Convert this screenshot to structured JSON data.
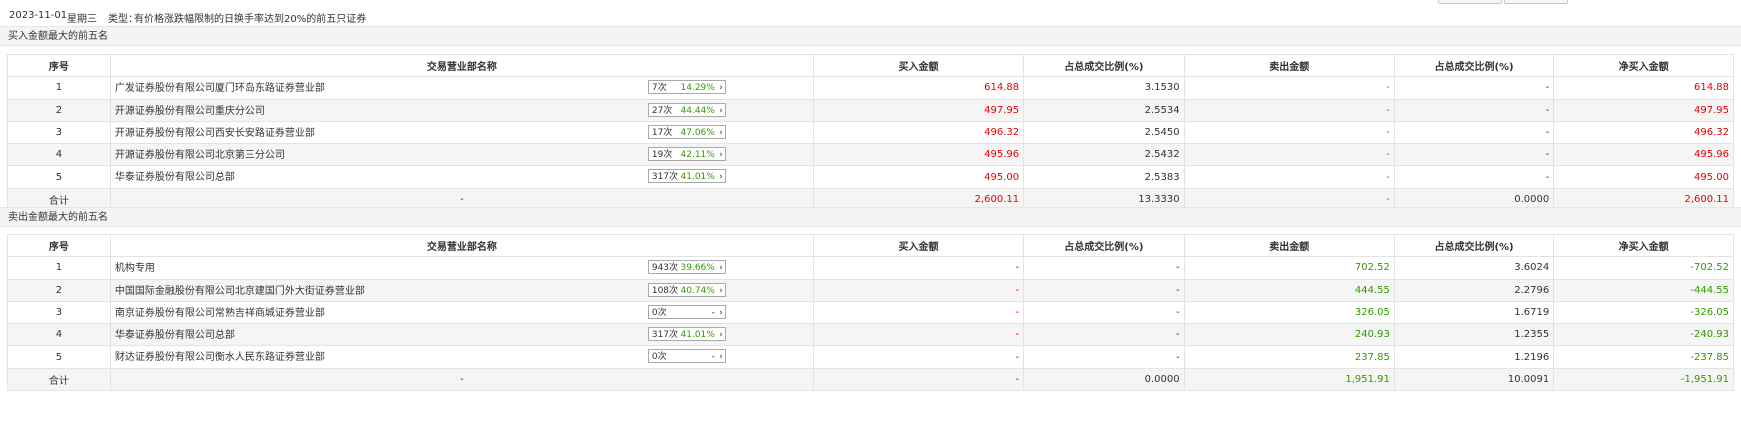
{
  "header": {
    "date": "2023-11-01",
    "weekday": "星期三",
    "type_label": "类型：",
    "type_value": "有价格涨跌幅限制的日换手率达到20%的前五只证券"
  },
  "columns": [
    "序号",
    "交易营业部名称",
    "买入金额",
    "占总成交比例(%)",
    "卖出金额",
    "占总成交比例(%)",
    "净买入金额"
  ],
  "buy_section": {
    "title": "买入金额最大的前五名",
    "rows": [
      {
        "no": "1",
        "name": "广发证券股份有限公司厦门环岛东路证券营业部",
        "count": "7次",
        "rate": "14.29%",
        "arrow": "›",
        "buy": "614.88",
        "buy_pct": "3.1530",
        "sell": "-",
        "sell_pct": "-",
        "net": "614.88"
      },
      {
        "no": "2",
        "name": "开源证券股份有限公司重庆分公司",
        "count": "27次",
        "rate": "44.44%",
        "arrow": "›",
        "buy": "497.95",
        "buy_pct": "2.5534",
        "sell": "-",
        "sell_pct": "-",
        "net": "497.95"
      },
      {
        "no": "3",
        "name": "开源证券股份有限公司西安长安路证券营业部",
        "count": "17次",
        "rate": "47.06%",
        "arrow": "›",
        "buy": "496.32",
        "buy_pct": "2.5450",
        "sell": "-",
        "sell_pct": "-",
        "net": "496.32"
      },
      {
        "no": "4",
        "name": "开源证券股份有限公司北京第三分公司",
        "count": "19次",
        "rate": "42.11%",
        "arrow": "›",
        "buy": "495.96",
        "buy_pct": "2.5432",
        "sell": "-",
        "sell_pct": "-",
        "net": "495.96"
      },
      {
        "no": "5",
        "name": "华泰证券股份有限公司总部",
        "count": "317次",
        "rate": "41.01%",
        "arrow": "›",
        "buy": "495.00",
        "buy_pct": "2.5383",
        "sell": "-",
        "sell_pct": "-",
        "net": "495.00"
      }
    ],
    "total": {
      "label": "合计",
      "name": "-",
      "buy": "2,600.11",
      "buy_pct": "13.3330",
      "sell": "-",
      "sell_pct": "0.0000",
      "net": "2,600.11"
    }
  },
  "sell_section": {
    "title": "卖出金额最大的前五名",
    "rows": [
      {
        "no": "1",
        "name": "机构专用",
        "count": "943次",
        "rate": "39.66%",
        "arrow": "›",
        "buy": "-",
        "buy_pct": "-",
        "sell": "702.52",
        "sell_pct": "3.6024",
        "net": "-702.52"
      },
      {
        "no": "2",
        "name": "中国国际金融股份有限公司北京建国门外大街证券营业部",
        "count": "108次",
        "rate": "40.74%",
        "arrow": "›",
        "buy": "-",
        "buy_pct": "-",
        "sell": "444.55",
        "sell_pct": "2.2796",
        "net": "-444.55"
      },
      {
        "no": "3",
        "name": "南京证券股份有限公司常熟吉祥商城证券营业部",
        "count": "0次",
        "rate": "-",
        "arrow": "›",
        "buy": "-",
        "buy_pct": "-",
        "sell": "326.05",
        "sell_pct": "1.6719",
        "net": "-326.05"
      },
      {
        "no": "4",
        "name": "华泰证券股份有限公司总部",
        "count": "317次",
        "rate": "41.01%",
        "arrow": "›",
        "buy": "-",
        "buy_pct": "-",
        "sell": "240.93",
        "sell_pct": "1.2355",
        "net": "-240.93"
      },
      {
        "no": "5",
        "name": "财达证券股份有限公司衡水人民东路证券营业部",
        "count": "0次",
        "rate": "-",
        "arrow": "›",
        "buy": "-",
        "buy_pct": "-",
        "sell": "237.85",
        "sell_pct": "1.2196",
        "net": "-237.85"
      }
    ],
    "total": {
      "label": "合计",
      "name": "-",
      "buy": "-",
      "buy_pct": "0.0000",
      "sell": "1,951.91",
      "sell_pct": "10.0091",
      "net": "-1,951.91"
    }
  },
  "colors": {
    "up": "#e60000",
    "down": "#339900",
    "stripe": "#f5f5f5",
    "border": "#e3e3e3"
  }
}
